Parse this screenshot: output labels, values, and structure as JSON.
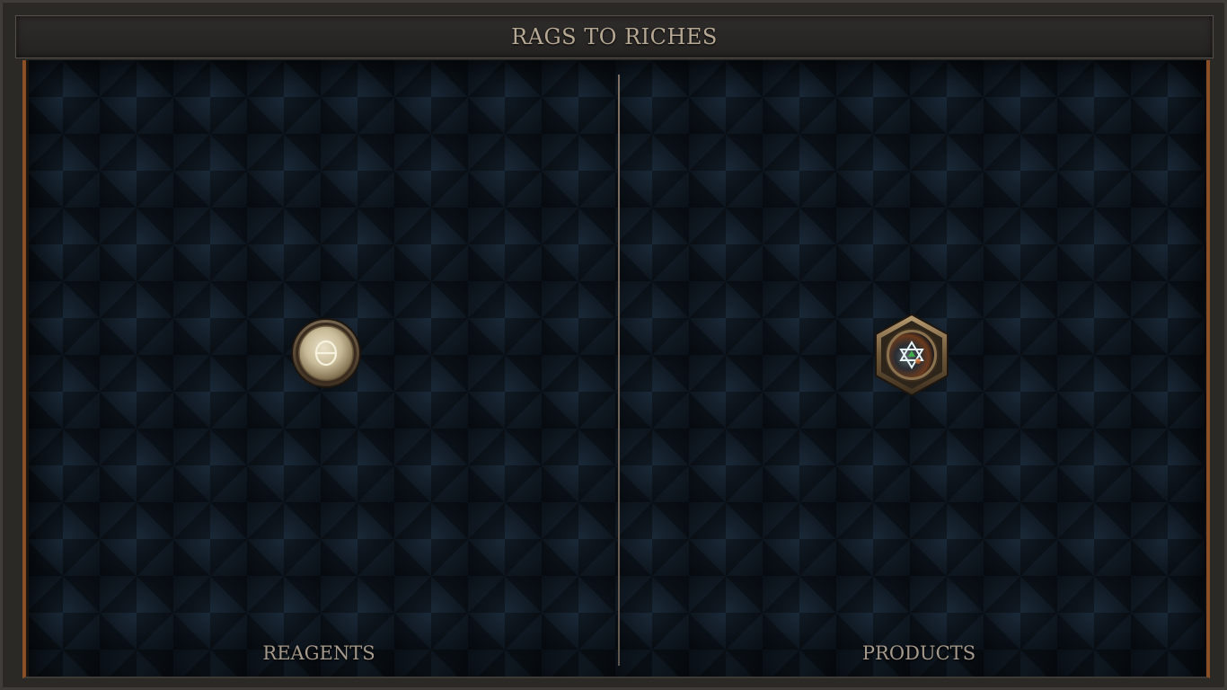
{
  "title": "RAGS TO RICHES",
  "panels": {
    "reagents": {
      "label": "REAGENTS",
      "item": {
        "icon": "theta-coin-icon"
      }
    },
    "products": {
      "label": "PRODUCTS",
      "item": {
        "icon": "hexagram-gem-icon"
      }
    }
  },
  "colors": {
    "frame": "#2b2926",
    "title_text": "#b7a894",
    "board": "#0f1821",
    "accent_copper": "#8a4f25",
    "label_text": "#a69a8c"
  }
}
